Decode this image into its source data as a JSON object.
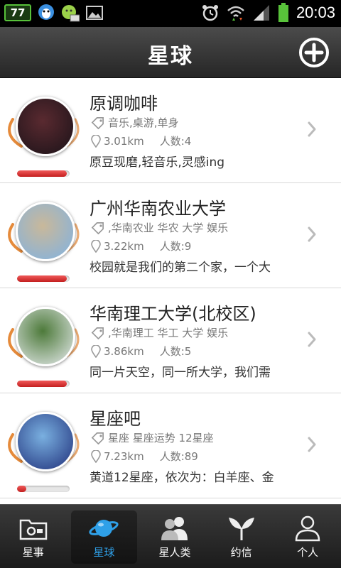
{
  "status_bar": {
    "battery_level": "77",
    "time": "20:03"
  },
  "header": {
    "title": "星球"
  },
  "planets": [
    {
      "name": "原调咖啡",
      "tags": "音乐,桌游,单身",
      "distance": "3.01km",
      "members": "人数:4",
      "description": "原豆现磨,轻音乐,灵感ing",
      "activity": 0.95,
      "avatar_colors": [
        "#1a1218",
        "#5a2a30"
      ]
    },
    {
      "name": "广州华南农业大学",
      "tags": ",华南农业 华农 大学 娱乐",
      "distance": "3.22km",
      "members": "人数:9",
      "description": "校园就是我们的第二个家，一个大",
      "activity": 0.95,
      "avatar_colors": [
        "#7fb2e3",
        "#c9b89a"
      ]
    },
    {
      "name": "华南理工大学(北校区)",
      "tags": ",华南理工 华工 大学 娱乐",
      "distance": "3.86km",
      "members": "人数:5",
      "description": "同一片天空，同一所大学，我们需",
      "activity": 0.95,
      "avatar_colors": [
        "#e8ecef",
        "#4d7a3a"
      ]
    },
    {
      "name": "星座吧",
      "tags": "星座 星座运势 12星座",
      "distance": "7.23km",
      "members": "人数:89",
      "description": "黄道12星座，依次为：白羊座、金",
      "activity": 0.18,
      "avatar_colors": [
        "#1f2f7a",
        "#7ab0e0"
      ]
    }
  ],
  "nav": {
    "items": [
      {
        "label": "星事",
        "icon": "camera-folder-icon"
      },
      {
        "label": "星球",
        "icon": "planet-icon"
      },
      {
        "label": "星人类",
        "icon": "people-icon"
      },
      {
        "label": "约信",
        "icon": "sprout-icon"
      },
      {
        "label": "个人",
        "icon": "person-icon"
      }
    ],
    "active": "星球"
  },
  "colors": {
    "accent": "#2fa0e8",
    "progress": "#d42a2a",
    "orbit": "#e58a3a"
  }
}
